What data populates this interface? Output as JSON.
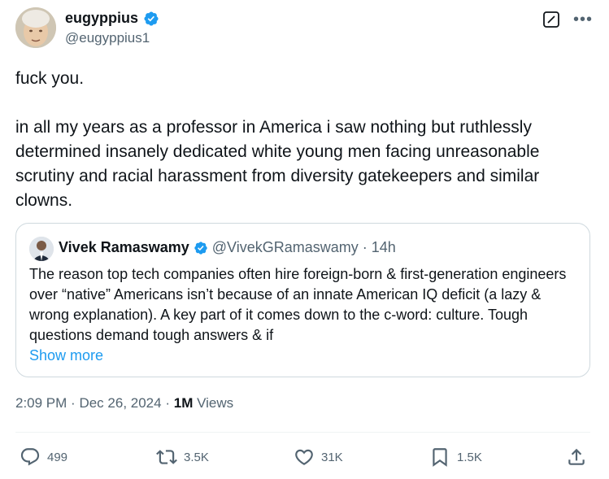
{
  "author": {
    "display_name": "eugyppius",
    "handle": "@eugyppius1",
    "verified": true
  },
  "icons": {
    "grok": "grok-icon",
    "more": "more-icon",
    "verified": "verified-badge-icon",
    "reply": "reply-icon",
    "retweet": "retweet-icon",
    "like": "like-icon",
    "bookmark": "bookmark-icon",
    "share": "share-icon"
  },
  "tweet": {
    "line1": "fuck you.",
    "line2": "in all my years as a professor in America i saw nothing but ruthlessly determined insanely dedicated white young men facing unreasonable scrutiny and racial harassment from diversity gatekeepers and similar clowns."
  },
  "quote": {
    "display_name": "Vivek Ramaswamy",
    "handle": "@VivekGRamaswamy",
    "separator": "·",
    "time": "14h",
    "text": "The reason top tech companies often hire foreign-born & first-generation engineers over “native” Americans isn’t because of an innate American IQ deficit (a lazy & wrong explanation). A key part of it comes down to the c-word: culture. Tough questions demand tough answers & if",
    "show_more": "Show more"
  },
  "meta": {
    "time": "2:09 PM",
    "sep1": "·",
    "date": "Dec 26, 2024",
    "sep2": "·",
    "views_count": "1M",
    "views_label": "Views"
  },
  "actions": {
    "replies": "499",
    "reposts": "3.5K",
    "likes": "31K",
    "bookmarks": "1.5K"
  },
  "colors": {
    "text": "#0f1419",
    "secondary": "#536471",
    "link": "#1d9bf0",
    "verified": "#1d9bf0",
    "border": "#cfd9de"
  }
}
